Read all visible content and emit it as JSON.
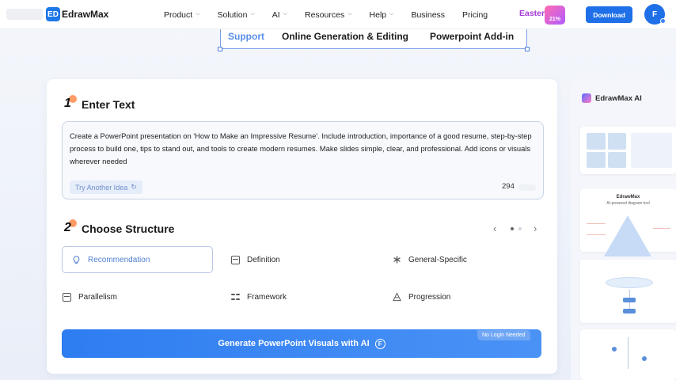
{
  "nav": {
    "logo_mark": "ED",
    "logo_text": "EdrawMax",
    "items": [
      {
        "label": "Product",
        "has_dropdown": true
      },
      {
        "label": "Solution",
        "has_dropdown": true
      },
      {
        "label": "AI",
        "has_dropdown": true
      },
      {
        "label": "Resources",
        "has_dropdown": true
      },
      {
        "label": "Help",
        "has_dropdown": true
      },
      {
        "label": "Business",
        "has_dropdown": false
      },
      {
        "label": "Pricing",
        "has_dropdown": false
      }
    ],
    "chevron": "⌵",
    "easter_label": "Easter",
    "easter_badge": "21%",
    "download_label": "Download",
    "avatar_letter": "F"
  },
  "subnav": {
    "items": [
      "Support",
      "Online Generation & Editing",
      "Powerpoint Add-in"
    ],
    "active_index": 0
  },
  "step1": {
    "number": "1",
    "title": "Enter Text",
    "prompt_text": "Create a PowerPoint presentation on 'How to Make an Impressive Resume'. Include introduction, importance of a good resume, step-by-step process to build one, tips to stand out, and tools to create modern resumes. Make slides simple, clear, and professional. Add icons or visuals wherever needed",
    "try_another_label": "Try Another Idea",
    "refresh_glyph": "↻",
    "char_count": "294"
  },
  "step2": {
    "number": "2",
    "title": "Choose Structure",
    "prev_glyph": "‹",
    "next_glyph": "›",
    "page_index": 0,
    "page_count": 2,
    "options": [
      {
        "label": "Recommendation",
        "icon": "bulb-icon",
        "selected": true
      },
      {
        "label": "Definition",
        "icon": "definition-icon",
        "selected": false
      },
      {
        "label": "General-Specific",
        "icon": "asterisk-icon",
        "selected": false
      },
      {
        "label": "Parallelism",
        "icon": "parallel-icon",
        "selected": false
      },
      {
        "label": "Framework",
        "icon": "grid-icon",
        "selected": false
      },
      {
        "label": "Progression",
        "icon": "steps-icon",
        "selected": false
      }
    ]
  },
  "generate": {
    "label": "Generate PowerPoint Visuals with AI",
    "coin_glyph": "F",
    "badge": "No Login Needed"
  },
  "preview": {
    "title": "EdrawMax AI",
    "thumb2_title": "EdrawMax",
    "thumb2_sub": "AI-powered diagram tool"
  },
  "colors": {
    "accent": "#1e6fe8",
    "selected_text": "#4f7fd0",
    "easter": "#a63ad9",
    "step_accent": "#ff8a4c"
  }
}
